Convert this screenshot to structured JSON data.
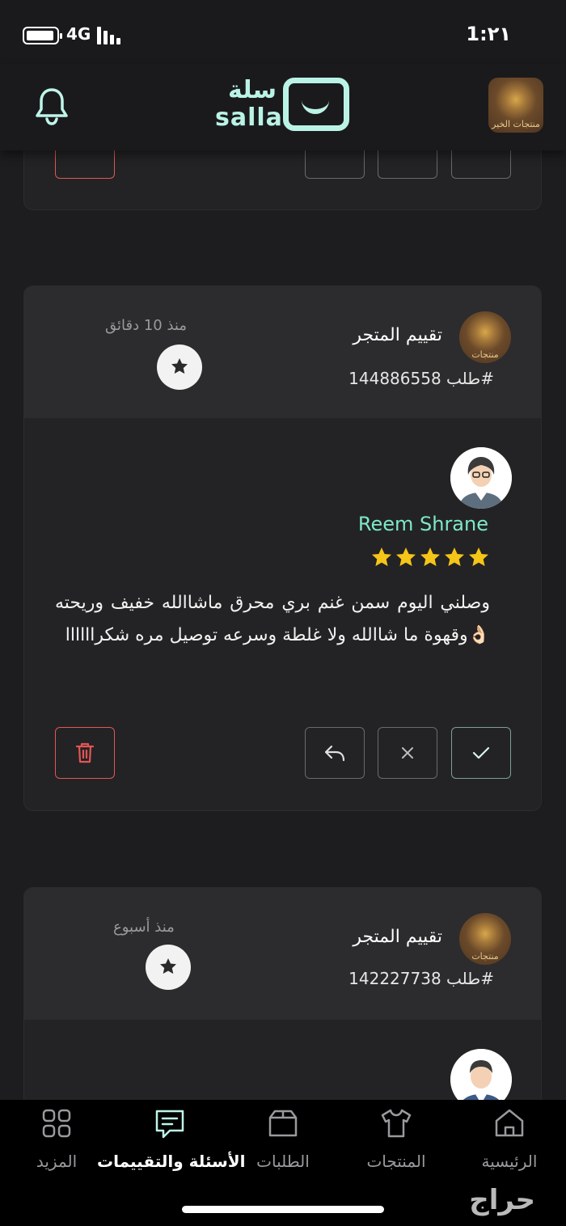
{
  "status_bar": {
    "network": "4G",
    "time": "1:٢١"
  },
  "header": {
    "logo_ar": "سلة",
    "logo_en": "salla",
    "store_badge": "منتجات الخير"
  },
  "reviews": [
    {
      "title": "تقييم المتجر",
      "order": "طلب 144886558#",
      "time_ago": "منذ 10 دقائق",
      "reviewer": "Reem Shrane",
      "rating": 5,
      "text": "وصلني اليوم سمن غنم بري محرق ماشاالله خفيف وريحته 👌🏻وقهوة ما شاالله ولا غلطة وسرعه توصيل مره شكراااااا"
    },
    {
      "title": "تقييم المتجر",
      "order": "طلب 142227738#",
      "time_ago": "منذ أسبوع"
    }
  ],
  "colors": {
    "accent": "#baf3e6",
    "name": "#7ee8c8",
    "star": "#f5c518",
    "delete": "#e45555"
  },
  "nav": [
    {
      "label": "الرئيسية",
      "icon": "home-icon"
    },
    {
      "label": "المنتجات",
      "icon": "shirt-icon"
    },
    {
      "label": "الطلبات",
      "icon": "box-icon"
    },
    {
      "label": "الأسئلة والتقييمات",
      "icon": "chat-icon",
      "active": true
    },
    {
      "label": "المزيد",
      "icon": "grid-icon"
    }
  ],
  "watermark": "حراج"
}
